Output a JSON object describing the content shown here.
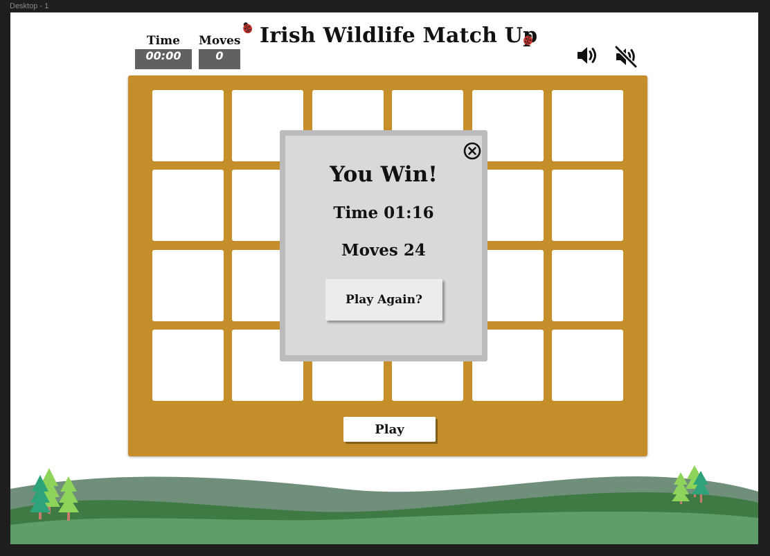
{
  "frame": {
    "label": "Desktop - 1"
  },
  "header": {
    "title": "Irish Wildlife Match Up",
    "time_label": "Time",
    "time_value": "00:00",
    "moves_label": "Moves",
    "moves_value": "0"
  },
  "board": {
    "rows": 4,
    "columns": 6,
    "play_label": "Play"
  },
  "modal": {
    "title": "You Win!",
    "time_text": "Time 01:16",
    "moves_text": "Moves 24",
    "button_label": "Play Again?"
  },
  "icons": {
    "sound_on": "speaker-on-icon",
    "sound_off": "speaker-muted-icon",
    "close": "circle-close-icon",
    "decoration": "ladybug-icon"
  },
  "colors": {
    "board": "#c48f2a",
    "stat_box": "#616161",
    "modal_border": "#bbbbbb",
    "modal_fill": "#d9d9d9",
    "hill_light": "#6f8f7a",
    "hill_dark": "#3f7a45",
    "hill_front": "#5e9e6a"
  }
}
